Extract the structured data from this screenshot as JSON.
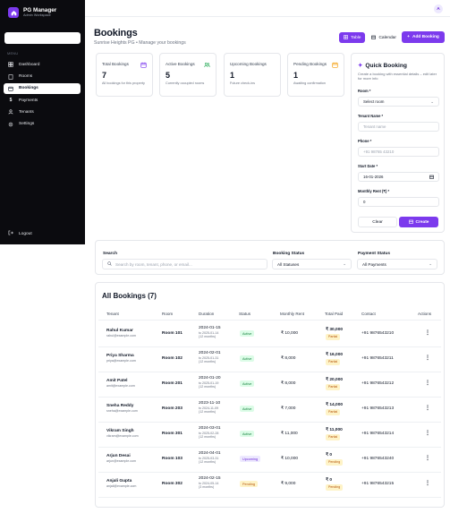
{
  "sidebar": {
    "brand_title": "PG Manager",
    "brand_sub": "Admin Workspace",
    "menu_label": "MENU",
    "items": [
      {
        "label": "Dashboard",
        "icon": "dashboard-icon"
      },
      {
        "label": "Rooms",
        "icon": "rooms-icon"
      },
      {
        "label": "Bookings",
        "icon": "bookings-icon",
        "active": true
      },
      {
        "label": "Payments",
        "icon": "payments-icon"
      },
      {
        "label": "Tenants",
        "icon": "tenants-icon"
      },
      {
        "label": "Settings",
        "icon": "settings-icon"
      }
    ],
    "logout_label": "Logout"
  },
  "header": {
    "avatar_initial": "A"
  },
  "page": {
    "title": "Bookings",
    "subtitle": "Sunrise Heights PG • Manage your bookings",
    "view_table": "Table",
    "view_calendar": "Calendar",
    "add_button": "Add Booking"
  },
  "stats": [
    {
      "label": "Total Bookings",
      "value": "7",
      "hint": "All bookings for this property",
      "icon": "calendar-icon"
    },
    {
      "label": "Active Bookings",
      "value": "5",
      "hint": "Currently occupied rooms",
      "icon": "users-icon"
    },
    {
      "label": "Upcoming Bookings",
      "value": "1",
      "hint": "Future check-ins",
      "icon": "calendar-icon"
    },
    {
      "label": "Pending Bookings",
      "value": "1",
      "hint": "Awaiting confirmation",
      "icon": "calendar-icon"
    }
  ],
  "quick_booking": {
    "title": "Quick Booking",
    "description": "Create a booking with essential details – edit later for more info",
    "room_label": "Room *",
    "room_value": "Select room",
    "tenant_label": "Tenant Name *",
    "tenant_placeholder": "Tenant name",
    "phone_label": "Phone *",
    "phone_placeholder": "+91 98765 43210",
    "start_label": "Start Date *",
    "start_value": "16-01-2026",
    "rent_label": "Monthly Rent (₹) *",
    "rent_value": "0",
    "clear_label": "Clear",
    "create_label": "Create"
  },
  "filters": {
    "search_label": "Search",
    "search_placeholder": "Search by room, tenant, phone, or email...",
    "status_label": "Booking Status",
    "status_value": "All Statuses",
    "payment_label": "Payment Status",
    "payment_value": "All Payments"
  },
  "table": {
    "title": "All Bookings (7)",
    "headers": [
      "Tenant",
      "Room",
      "Duration",
      "Status",
      "Monthly Rent",
      "Total Paid",
      "Contact",
      "Actions"
    ],
    "rows": [
      {
        "name": "Rahul Kumar",
        "email": "rahul@example.com",
        "room": "Room 101",
        "start": "2024-01-15",
        "end": "to 2025-01-14",
        "months": "(12 months)",
        "status": "Active",
        "rent": "₹ 10,000",
        "paid": "₹ 30,000",
        "paid_status": "Partial",
        "contact": "+91 9876543210"
      },
      {
        "name": "Priya Sharma",
        "email": "priya@example.com",
        "room": "Room 102",
        "start": "2024-02-01",
        "end": "to 2025-01-31",
        "months": "(12 months)",
        "status": "Active",
        "rent": "₹ 8,000",
        "paid": "₹ 16,000",
        "paid_status": "Partial",
        "contact": "+91 9876543211"
      },
      {
        "name": "Amit Patel",
        "email": "amit@example.com",
        "room": "Room 201",
        "start": "2024-01-20",
        "end": "to 2025-01-19",
        "months": "(12 months)",
        "status": "Active",
        "rent": "₹ 8,000",
        "paid": "₹ 20,000",
        "paid_status": "Partial",
        "contact": "+91 9876543212"
      },
      {
        "name": "Sneha Reddy",
        "email": "sneha@example.com",
        "room": "Room 203",
        "start": "2023-11-10",
        "end": "to 2024-11-09",
        "months": "(12 months)",
        "status": "Active",
        "rent": "₹ 7,000",
        "paid": "₹ 14,000",
        "paid_status": "Partial",
        "contact": "+91 9876543213"
      },
      {
        "name": "Vikram Singh",
        "email": "vikram@example.com",
        "room": "Room 301",
        "start": "2024-03-01",
        "end": "to 2025-02-28",
        "months": "(12 months)",
        "status": "Active",
        "rent": "₹ 11,000",
        "paid": "₹ 11,000",
        "paid_status": "Partial",
        "contact": "+91 9876543214"
      },
      {
        "name": "Arjun Desai",
        "email": "arjun@example.com",
        "room": "Room 103",
        "start": "2024-04-01",
        "end": "to 2025-03-31",
        "months": "(12 months)",
        "status": "Upcoming",
        "rent": "₹ 10,000",
        "paid": "₹ 0",
        "paid_status": "Pending",
        "contact": "+91 9876543240"
      },
      {
        "name": "Anjali Gupta",
        "email": "anjali@example.com",
        "room": "Room 302",
        "start": "2024-02-15",
        "end": "to 2024-05-14",
        "months": "(3 months)",
        "status": "Pending",
        "rent": "₹ 9,000",
        "paid": "₹ 0",
        "paid_status": "Pending",
        "contact": "+91 9876543215"
      }
    ]
  },
  "colors": {
    "accent": "#7c3aed",
    "sidebar_bg": "#0b0b0f"
  }
}
